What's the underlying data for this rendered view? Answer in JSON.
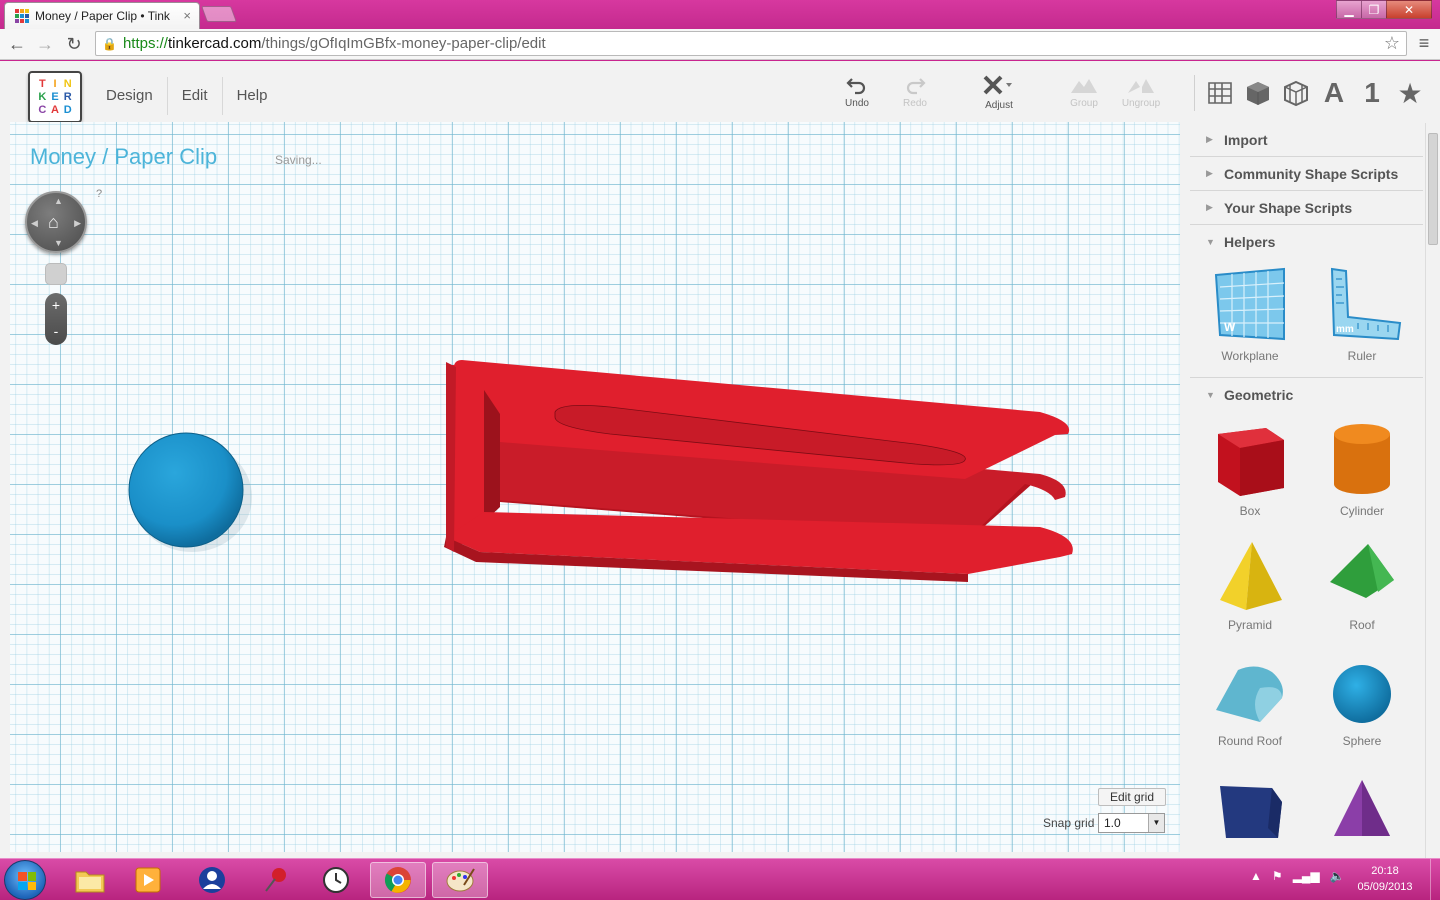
{
  "browser": {
    "tab_title": "Money / Paper Clip • Tink",
    "tab_close": "×",
    "url_scheme": "https://",
    "url_host": "tinkercad.com",
    "url_path": "/things/gOfIqImGBfx-money-paper-clip/edit",
    "window_min": "▁",
    "window_max": "❐",
    "window_close": "✕"
  },
  "app": {
    "logo_letters": [
      "T",
      "I",
      "N",
      "K",
      "E",
      "R",
      "C",
      "A",
      "D"
    ],
    "menu": [
      "Design",
      "Edit",
      "Help"
    ],
    "tools": {
      "undo": "Undo",
      "redo": "Redo",
      "adjust": "Adjust",
      "group": "Group",
      "ungroup": "Ungroup"
    },
    "view_icons": {
      "text": "A",
      "number": "1"
    }
  },
  "workplane": {
    "project_title": "Money / Paper Clip",
    "status": "Saving...",
    "help": "?",
    "zoom_in": "+",
    "zoom_out": "-",
    "edit_grid": "Edit grid",
    "snap_grid_label": "Snap grid",
    "snap_grid_value": "1.0"
  },
  "sidebar": {
    "sections": {
      "import": "Import",
      "community": "Community Shape Scripts",
      "your_scripts": "Your Shape Scripts",
      "helpers": "Helpers",
      "geometric": "Geometric"
    },
    "helpers": [
      "Workplane",
      "Ruler"
    ],
    "geometric": [
      "Box",
      "Cylinder",
      "Pyramid",
      "Roof",
      "Round Roof",
      "Sphere"
    ]
  },
  "taskbar": {
    "time": "20:18",
    "date": "05/09/2013"
  },
  "colors": {
    "accent": "#4cb4d9",
    "clip_red": "#e01f2d",
    "sphere_blue": "#1a8fc8",
    "taskbar": "#c42a8e"
  }
}
